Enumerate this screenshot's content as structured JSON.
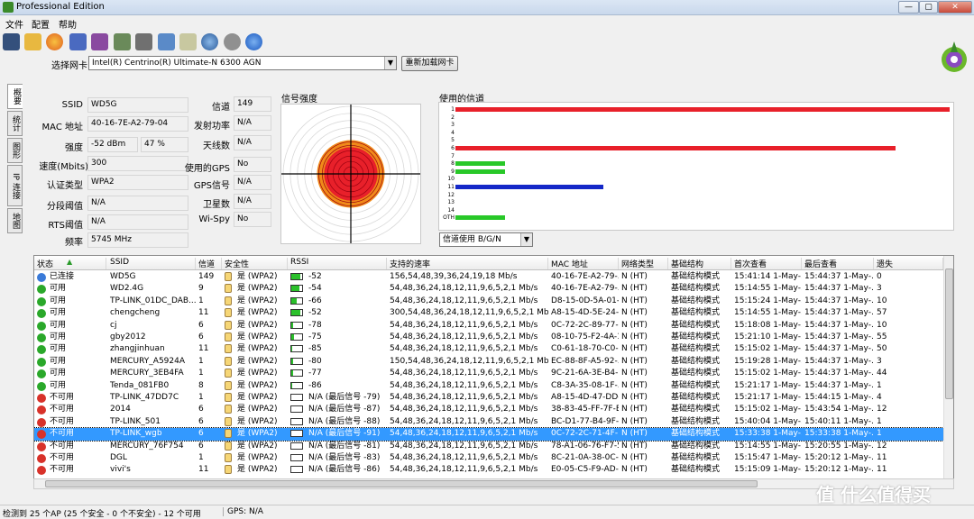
{
  "window": {
    "title": "Professional Edition",
    "minimize": "—",
    "maximize": "▢",
    "close": "✕"
  },
  "menu": [
    "文件",
    "配置",
    "帮助"
  ],
  "toolbar_icons": [
    "save-icon",
    "open-folder-icon",
    "scan-icon",
    "adapter-icon",
    "filter-icon",
    "export-icon",
    "print-icon",
    "check-icon",
    "info-icon",
    "globe-icon",
    "network-icon",
    "help-icon"
  ],
  "nic": {
    "label": "选择网卡",
    "value": "Intel(R) Centrino(R) Ultimate-N 6300 AGN",
    "reload": "重新加载网卡"
  },
  "side_tabs": [
    "概要",
    "统计",
    "图形",
    "IP 连接",
    "地图"
  ],
  "details": {
    "ssid_label": "SSID",
    "ssid": "WD5G",
    "mac_label": "MAC 地址",
    "mac": "40-16-7E-A2-79-04",
    "strength_label": "强度",
    "strength_dbm": "-52 dBm",
    "strength_pct": "47 %",
    "rate_label": "速度(Mbits)",
    "rate": "300",
    "auth_label": "认证类型",
    "auth": "WPA2",
    "frag_label": "分段阈值",
    "frag": "N/A",
    "rts_label": "RTS阈值",
    "rts": "N/A",
    "freq_label": "频率",
    "freq": "5745 MHz",
    "channel_label": "信道",
    "channel": "149",
    "txpower_label": "发射功率",
    "txpower": "N/A",
    "antenna_label": "天线数",
    "antenna": "N/A",
    "gps_use_label": "使用的GPS",
    "gps_use": "No",
    "gps_sig_label": "GPS信号",
    "gps_sig": "N/A",
    "sat_label": "卫星数",
    "sat": "N/A",
    "wispy_label": "Wi-Spy",
    "wispy": "No"
  },
  "signal_title": "信号强度",
  "channel_panel": {
    "title": "使用的信道",
    "labels": [
      "1",
      "2",
      "3",
      "4",
      "5",
      "6",
      "7",
      "8",
      "9",
      "10",
      "11",
      "12",
      "13",
      "14",
      "OTH"
    ],
    "bars": [
      {
        "channel": "1",
        "fraction": 1.0,
        "color": "#e8202a"
      },
      {
        "channel": "6",
        "fraction": 0.89,
        "color": "#e8202a"
      },
      {
        "channel": "8",
        "fraction": 0.1,
        "color": "#28c828"
      },
      {
        "channel": "9",
        "fraction": 0.1,
        "color": "#28c828"
      },
      {
        "channel": "11",
        "fraction": 0.3,
        "color": "#1428c8"
      },
      {
        "channel": "OTH",
        "fraction": 0.1,
        "color": "#28c828"
      }
    ],
    "band_select": "信道使用 B/G/N"
  },
  "table": {
    "headers": [
      "状态",
      "SSID",
      "信道",
      "安全性",
      "RSSI",
      "支持的速率",
      "MAC 地址",
      "网络类型",
      "基础结构",
      "首次查看",
      "最后查看",
      "遗失"
    ],
    "rows": [
      {
        "status": "已连接",
        "color": "#3a7ad8",
        "ssid": "WD5G",
        "ch": "149",
        "sec": "是 (WPA2)",
        "rssi": "-52",
        "bar": 0.8,
        "rates": "156,54,48,39,36,24,19,18 Mb/s",
        "mac": "40-16-7E-A2-79-...",
        "nettype": "N (HT)",
        "infra": "基础结构模式",
        "first": "15:41:14 1-May-...",
        "last": "15:44:37 1-May-...",
        "lost": "0"
      },
      {
        "status": "可用",
        "color": "#2aa82a",
        "ssid": "WD2.4G",
        "ch": "9",
        "sec": "是 (WPA2)",
        "rssi": "-54",
        "bar": 0.75,
        "rates": "54,48,36,24,18,12,11,9,6,5,2,1 Mb/s",
        "mac": "40-16-7E-A2-79-...",
        "nettype": "N (HT)",
        "infra": "基础结构模式",
        "first": "15:14:55 1-May-...",
        "last": "15:44:37 1-May-...",
        "lost": "3"
      },
      {
        "status": "可用",
        "color": "#2aa82a",
        "ssid": "TP-LINK_01DC_DAB...",
        "ch": "1",
        "sec": "是 (WPA2)",
        "rssi": "-66",
        "bar": 0.5,
        "rates": "54,48,36,24,18,12,11,9,6,5,2,1 Mb/s",
        "mac": "D8-15-0D-5A-01-...",
        "nettype": "N (HT)",
        "infra": "基础结构模式",
        "first": "15:15:24 1-May-...",
        "last": "15:44:37 1-May-...",
        "lost": "10"
      },
      {
        "status": "可用",
        "color": "#2aa82a",
        "ssid": "chengcheng",
        "ch": "11",
        "sec": "是 (WPA2)",
        "rssi": "-52",
        "bar": 0.8,
        "rates": "300,54,48,36,24,18,12,11,9,6,5,2,1 Mb/s",
        "mac": "A8-15-4D-5E-24-...",
        "nettype": "N (HT)",
        "infra": "基础结构模式",
        "first": "15:14:55 1-May-...",
        "last": "15:44:37 1-May-...",
        "lost": "57"
      },
      {
        "status": "可用",
        "color": "#2aa82a",
        "ssid": "cj",
        "ch": "6",
        "sec": "是 (WPA2)",
        "rssi": "-78",
        "bar": 0.2,
        "rates": "54,48,36,24,18,12,11,9,6,5,2,1 Mb/s",
        "mac": "0C-72-2C-89-77-...",
        "nettype": "N (HT)",
        "infra": "基础结构模式",
        "first": "15:18:08 1-May-...",
        "last": "15:44:37 1-May-...",
        "lost": "10"
      },
      {
        "status": "可用",
        "color": "#2aa82a",
        "ssid": "gby2012",
        "ch": "6",
        "sec": "是 (WPA2)",
        "rssi": "-75",
        "bar": 0.25,
        "rates": "54,48,36,24,18,12,11,9,6,5,2,1 Mb/s",
        "mac": "08-10-75-F2-4A-14",
        "nettype": "N (HT)",
        "infra": "基础结构模式",
        "first": "15:21:10 1-May-...",
        "last": "15:44:37 1-May-...",
        "lost": "55"
      },
      {
        "status": "可用",
        "color": "#2aa82a",
        "ssid": "zhangjinhuan",
        "ch": "11",
        "sec": "是 (WPA2)",
        "rssi": "-85",
        "bar": 0.1,
        "rates": "54,48,36,24,18,12,11,9,6,5,2,1 Mb/s",
        "mac": "C0-61-18-70-C0-...",
        "nettype": "N (HT)",
        "infra": "基础结构模式",
        "first": "15:15:02 1-May-...",
        "last": "15:44:37 1-May-...",
        "lost": "50"
      },
      {
        "status": "可用",
        "color": "#2aa82a",
        "ssid": "MERCURY_A5924A",
        "ch": "1",
        "sec": "是 (WPA2)",
        "rssi": "-80",
        "bar": 0.15,
        "rates": "150,54,48,36,24,18,12,11,9,6,5,2,1 Mb/s",
        "mac": "EC-88-8F-A5-92-...",
        "nettype": "N (HT)",
        "infra": "基础结构模式",
        "first": "15:19:28 1-May-...",
        "last": "15:44:37 1-May-...",
        "lost": "3"
      },
      {
        "status": "可用",
        "color": "#2aa82a",
        "ssid": "MERCURY_3EB4FA",
        "ch": "1",
        "sec": "是 (WPA2)",
        "rssi": "-77",
        "bar": 0.2,
        "rates": "54,48,36,24,18,12,11,9,6,5,2,1 Mb/s",
        "mac": "9C-21-6A-3E-B4-...",
        "nettype": "N (HT)",
        "infra": "基础结构模式",
        "first": "15:15:02 1-May-...",
        "last": "15:44:37 1-May-...",
        "lost": "44"
      },
      {
        "status": "可用",
        "color": "#2aa82a",
        "ssid": "Tenda_081FB0",
        "ch": "8",
        "sec": "是 (WPA2)",
        "rssi": "-86",
        "bar": 0.1,
        "rates": "54,48,36,24,18,12,11,9,6,5,2,1 Mb/s",
        "mac": "C8-3A-35-08-1F-...",
        "nettype": "N (HT)",
        "infra": "基础结构模式",
        "first": "15:21:17 1-May-...",
        "last": "15:44:37 1-May-...",
        "lost": "1"
      },
      {
        "status": "不可用",
        "color": "#d8322a",
        "ssid": "TP-LINK_47DD7C",
        "ch": "1",
        "sec": "是 (WPA2)",
        "rssi": "N/A (最后信号 -79)",
        "bar": 0,
        "rates": "54,48,36,24,18,12,11,9,6,5,2,1 Mb/s",
        "mac": "A8-15-4D-47-DD-...",
        "nettype": "N (HT)",
        "infra": "基础结构模式",
        "first": "15:21:17 1-May-...",
        "last": "15:44:15 1-May-...",
        "lost": "4"
      },
      {
        "status": "不可用",
        "color": "#d8322a",
        "ssid": "2014",
        "ch": "6",
        "sec": "是 (WPA2)",
        "rssi": "N/A (最后信号 -87)",
        "bar": 0,
        "rates": "54,48,36,24,18,12,11,9,6,5,2,1 Mb/s",
        "mac": "38-83-45-FF-7F-E0",
        "nettype": "N (HT)",
        "infra": "基础结构模式",
        "first": "15:15:02 1-May-...",
        "last": "15:43:54 1-May-...",
        "lost": "12"
      },
      {
        "status": "不可用",
        "color": "#d8322a",
        "ssid": "TP-LINK_501",
        "ch": "6",
        "sec": "是 (WPA2)",
        "rssi": "N/A (最后信号 -88)",
        "bar": 0,
        "rates": "54,48,36,24,18,12,11,9,6,5,2,1 Mb/s",
        "mac": "BC-D1-77-B4-9F-...",
        "nettype": "N (HT)",
        "infra": "基础结构模式",
        "first": "15:40:04 1-May-...",
        "last": "15:40:11 1-May-...",
        "lost": "1"
      },
      {
        "status": "不可用",
        "color": "#d8322a",
        "ssid": "TP-LINK_wgb",
        "ch": "6",
        "sec": "是 (WPA2)",
        "rssi": "N/A (最后信号 -91)",
        "bar": 0,
        "rates": "54,48,36,24,18,12,11,9,6,5,2,1 Mb/s",
        "mac": "0C-72-2C-71-4F-...",
        "nettype": "N (HT)",
        "infra": "基础结构模式",
        "first": "15:33:38 1-May-...",
        "last": "15:33:38 1-May-...",
        "lost": "1",
        "selected": true
      },
      {
        "status": "不可用",
        "color": "#d8322a",
        "ssid": "MERCURY_76F754",
        "ch": "6",
        "sec": "是 (WPA2)",
        "rssi": "N/A (最后信号 -81)",
        "bar": 0,
        "rates": "54,48,36,24,18,12,11,9,6,5,2,1 Mb/s",
        "mac": "78-A1-06-76-F7-54",
        "nettype": "N (HT)",
        "infra": "基础结构模式",
        "first": "15:14:55 1-May-...",
        "last": "15:20:55 1-May-...",
        "lost": "12"
      },
      {
        "status": "不可用",
        "color": "#d8322a",
        "ssid": "DGL",
        "ch": "1",
        "sec": "是 (WPA2)",
        "rssi": "N/A (最后信号 -83)",
        "bar": 0,
        "rates": "54,48,36,24,18,12,11,9,6,5,2,1 Mb/s",
        "mac": "8C-21-0A-38-0C-...",
        "nettype": "N (HT)",
        "infra": "基础结构模式",
        "first": "15:15:47 1-May-...",
        "last": "15:20:12 1-May-...",
        "lost": "11"
      },
      {
        "status": "不可用",
        "color": "#d8322a",
        "ssid": "vivi's",
        "ch": "11",
        "sec": "是 (WPA2)",
        "rssi": "N/A (最后信号 -86)",
        "bar": 0,
        "rates": "54,48,36,24,18,12,11,9,6,5,2,1 Mb/s",
        "mac": "E0-05-C5-F9-AD-...",
        "nettype": "N (HT)",
        "infra": "基础结构模式",
        "first": "15:15:09 1-May-...",
        "last": "15:20:12 1-May-...",
        "lost": "11"
      }
    ]
  },
  "status": {
    "left": "检测到 25 个AP (25 个安全 - 0 个不安全) - 12 个可用",
    "gps": "GPS: N/A"
  },
  "watermark": "值 什么值得买"
}
